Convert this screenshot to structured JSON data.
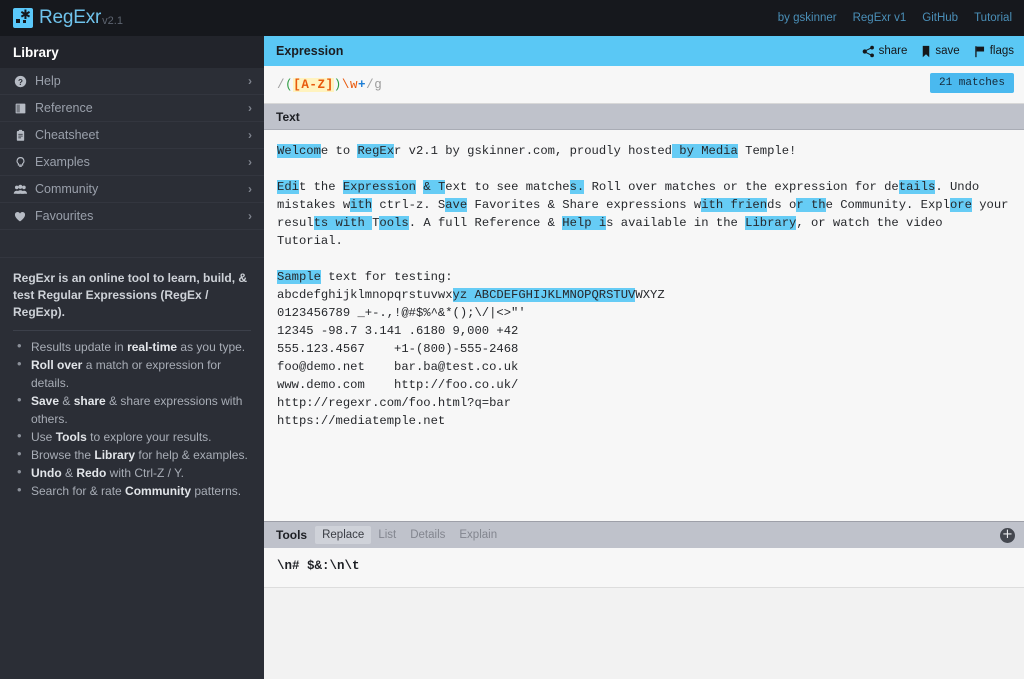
{
  "header": {
    "brand": "RegExr",
    "version": "v2.1",
    "logo_icon": "regexr-logo-icon",
    "nav": [
      {
        "label": "by gskinner"
      },
      {
        "label": "RegExr v1"
      },
      {
        "label": "GitHub"
      },
      {
        "label": "Tutorial"
      }
    ]
  },
  "sidebar": {
    "title": "Library",
    "items": [
      {
        "label": "Help",
        "icon": "question-circle-icon",
        "glyph": "?",
        "chevron": "›"
      },
      {
        "label": "Reference",
        "icon": "book-icon",
        "glyph": "▤",
        "chevron": "›"
      },
      {
        "label": "Cheatsheet",
        "icon": "clipboard-icon",
        "glyph": "⌸",
        "chevron": "›"
      },
      {
        "label": "Examples",
        "icon": "lightbulb-icon",
        "glyph": "○",
        "chevron": "›"
      },
      {
        "label": "Community",
        "icon": "people-icon",
        "glyph": "♟",
        "chevron": "›"
      },
      {
        "label": "Favourites",
        "icon": "heart-icon",
        "glyph": "♥",
        "chevron": "›"
      }
    ],
    "description": "RegExr is an online tool to learn, build, & test Regular Expressions (RegEx / RegExp).",
    "tips": [
      {
        "pre": "Results update in ",
        "bold": "real-time",
        "post": " as you type."
      },
      {
        "pre": "",
        "bold": "Roll over",
        "post": " a match or expression for details."
      },
      {
        "pre": "",
        "bold": "Save",
        "post": " & share expressions with others.",
        "bold2": "share",
        "mid": " & "
      },
      {
        "pre": "Use ",
        "bold": "Tools",
        "post": " to explore your results."
      },
      {
        "pre": "Browse the ",
        "bold": "Library",
        "post": " for help & examples."
      },
      {
        "pre": "",
        "bold": "Undo",
        "post": " with Ctrl-Z / Y.",
        "bold2": "Redo",
        "mid": " & "
      },
      {
        "pre": "Search for & rate ",
        "bold": "Community",
        "post": " patterns."
      }
    ]
  },
  "expression": {
    "title": "Expression",
    "actions": [
      {
        "label": "share",
        "icon": "share-nodes-icon"
      },
      {
        "label": "save",
        "icon": "bookmark-icon"
      },
      {
        "label": "flags",
        "icon": "flag-icon"
      }
    ],
    "pattern_full": "/([A-Z])\\w+/g",
    "tokens": {
      "slash_open": "/",
      "group_open": "(",
      "charset": "[A-Z]",
      "group_close": ")",
      "escape": "\\w",
      "quantifier": "+",
      "slash_close": "/",
      "flags": "g"
    },
    "matches_badge": "21 matches"
  },
  "text_panel": {
    "title": "Text",
    "lines": [
      "Welcome to RegExr v2.1 by gskinner.com, proudly hosted by Media Temple!",
      "",
      "Edit the Expression & Text to see matches. Roll over matches or the expression for details. Undo mistakes with ctrl-z. Save Favorites & Share expressions with friends or the Community. Explore your results with Tools. A full Reference & Help is available in the Library, or watch the video Tutorial.",
      "",
      "Sample text for testing:",
      "abcdefghijklmnopqrstuvwxyz ABCDEFGHIJKLMNOPQRSTUVWXYZ",
      "0123456789 _+-.,!@#$%^&*();\\/|<>\"'",
      "12345 -98.7 3.141 .6180 9,000 +42",
      "555.123.4567    +1-(800)-555-2468",
      "foo@demo.net    bar.ba@test.co.uk",
      "www.demo.com    http://foo.co.uk/",
      "http://regexr.com/foo.html?q=bar",
      "https://mediatemple.net"
    ]
  },
  "tools": {
    "title": "Tools",
    "tabs": [
      {
        "label": "Replace",
        "active": true
      },
      {
        "label": "List",
        "active": false
      },
      {
        "label": "Details",
        "active": false
      },
      {
        "label": "Explain",
        "active": false
      }
    ],
    "close_icon": "plus-circle-icon",
    "replace_value": "\\n# $&:\\n\\t"
  },
  "colors": {
    "accent_blue": "#5ac8f5",
    "highlight_blue": "#66ccf5",
    "topbar_dark": "#16181d",
    "sidebar_dark": "#2b2e36",
    "panel_gray": "#bfc2cb",
    "badge_blue": "#4ab9ef"
  }
}
